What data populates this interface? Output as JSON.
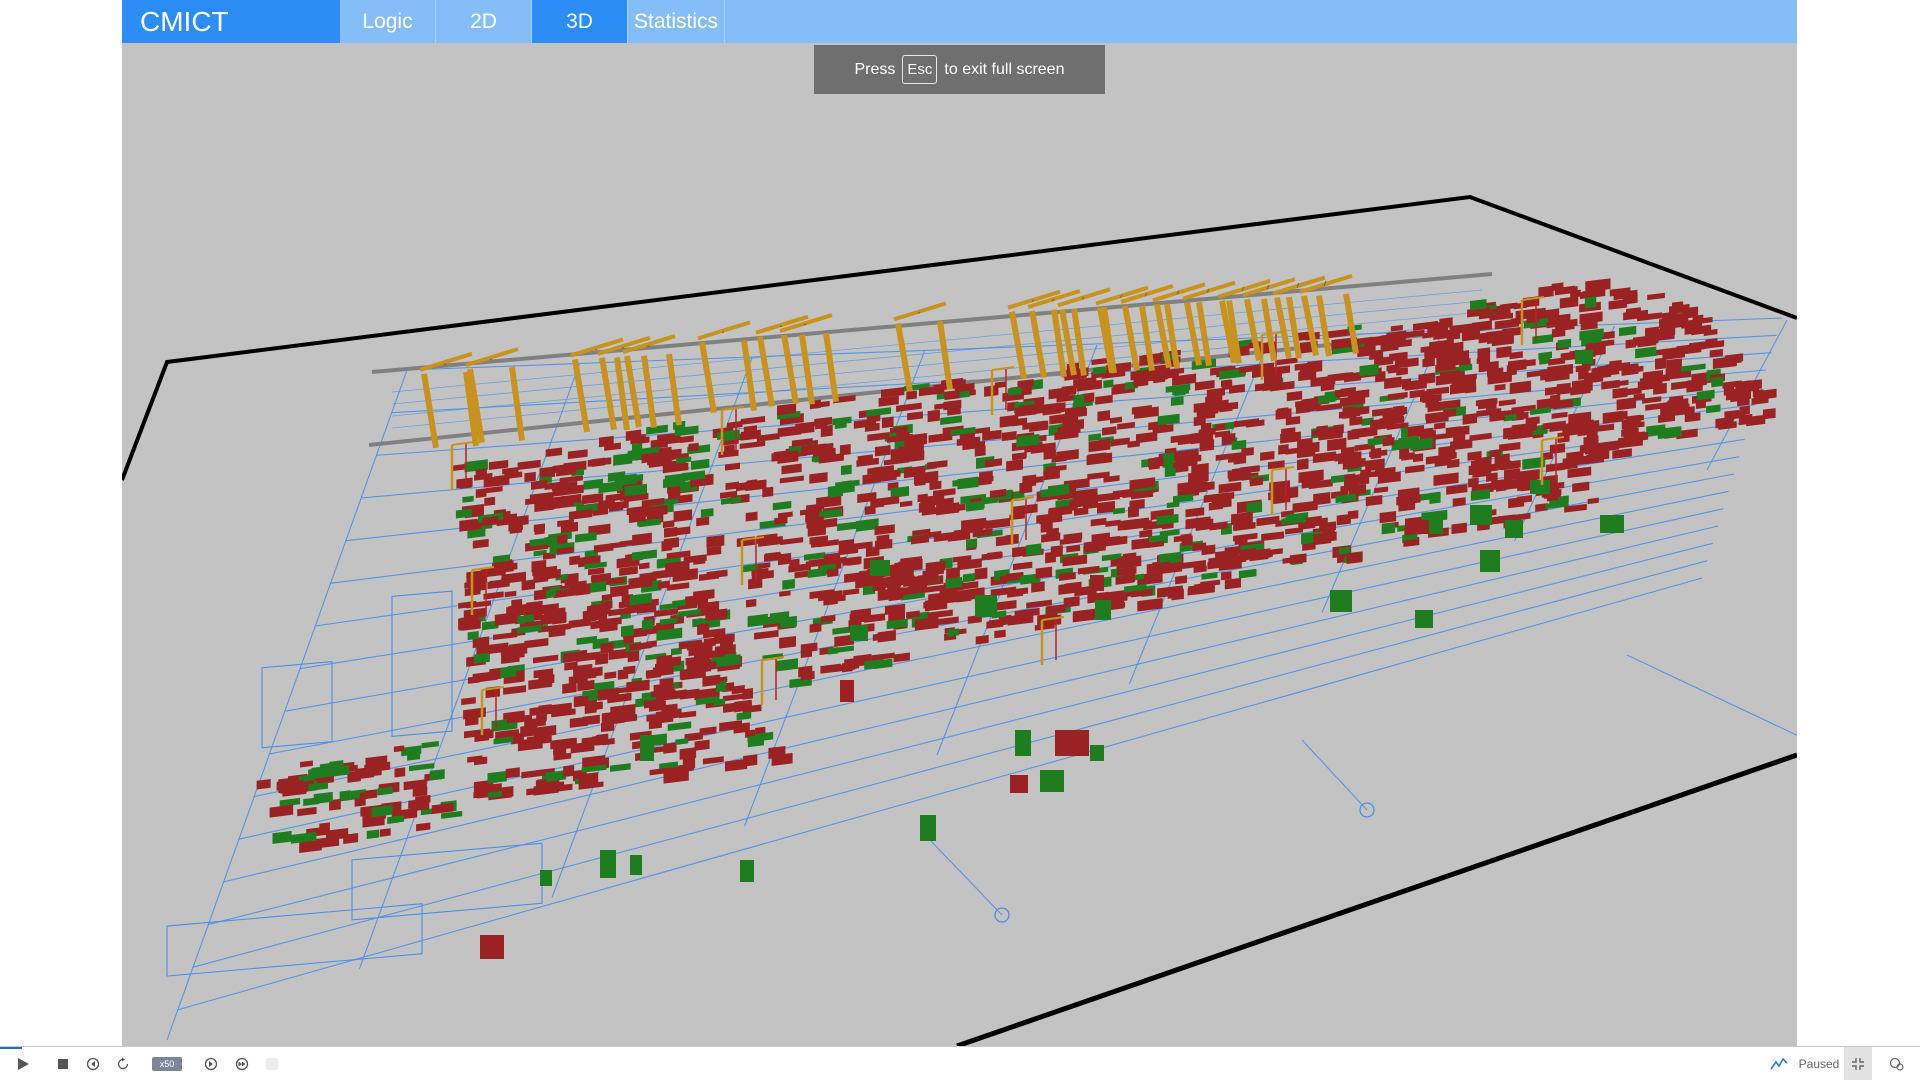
{
  "app": {
    "brand": "CMICT",
    "tabs": [
      {
        "label": "Logic",
        "active": false
      },
      {
        "label": "2D",
        "active": false
      },
      {
        "label": "3D",
        "active": true
      },
      {
        "label": "Statistics",
        "active": false
      }
    ]
  },
  "toast": {
    "prefix": "Press",
    "key": "Esc",
    "suffix": "to exit full screen"
  },
  "statusbar": {
    "speed": "x50",
    "state": "Paused",
    "icons": [
      "play-icon",
      "stop-icon",
      "step-back-icon",
      "reset-icon",
      "speed-badge",
      "step-forward-icon",
      "fast-forward-icon",
      "blank-slot",
      "chart-icon",
      "exit-fullscreen-icon",
      "settings-icon"
    ]
  },
  "colors": {
    "accent": "#2b8df5",
    "topbar": "#85bdf8",
    "viewport": "#c3c3c3",
    "crane": "#c8921e",
    "container_red": "#9b2222",
    "container_green": "#1f7d1f",
    "road_lines": "#4a90e8"
  }
}
